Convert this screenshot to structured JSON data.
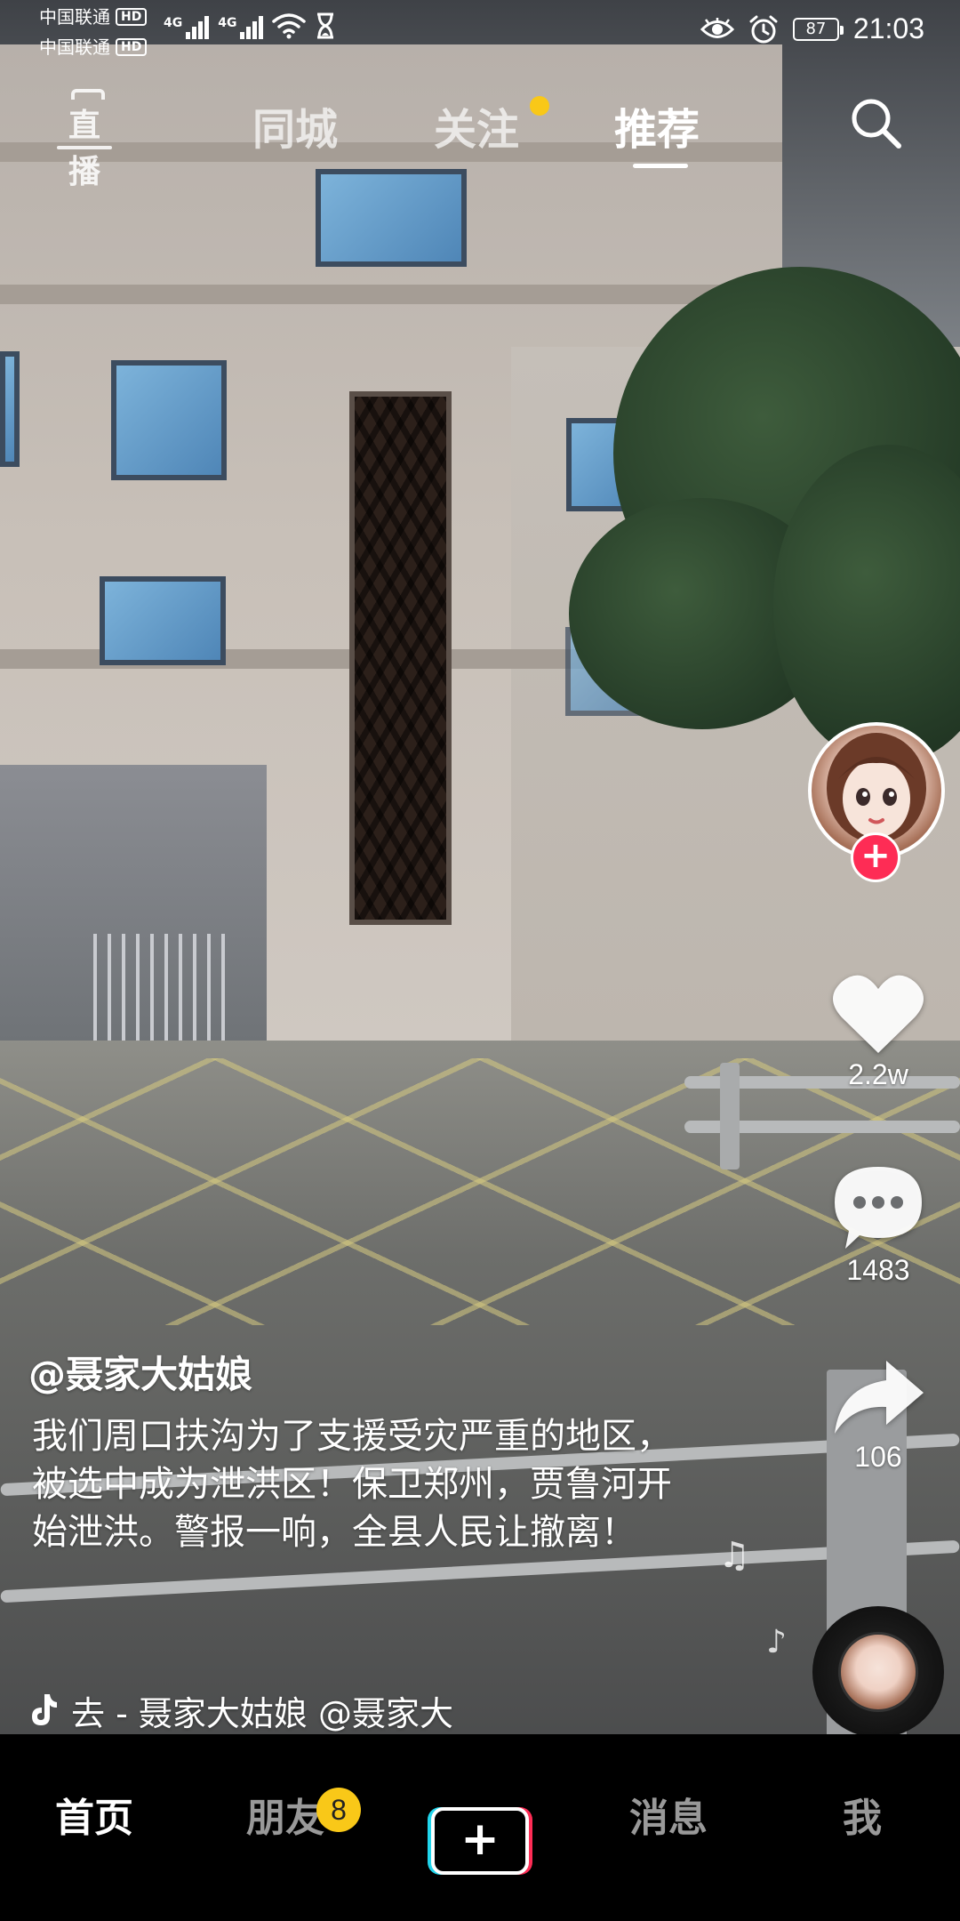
{
  "status_bar": {
    "carrier1": "中国联通",
    "carrier2": "中国联通",
    "hd": "HD",
    "net1": "4G",
    "net2": "4G",
    "battery": "87",
    "time": "21:03"
  },
  "top_nav": {
    "live": "直播",
    "tabs": [
      {
        "label": "同城"
      },
      {
        "label": "关注"
      },
      {
        "label": "推荐"
      }
    ],
    "active_tab": "推荐"
  },
  "actions": {
    "likes": "2.2w",
    "comments": "1483",
    "shares": "106"
  },
  "caption": {
    "author": "@聂家大姑娘",
    "description": "我们周口扶沟为了支援受灾严重的地区，被选中成为泄洪区！保卫郑州，贾鲁河开始泄洪。警报一响，全县人民让撤离！",
    "music": "去 - 聂家大姑娘    @聂家大"
  },
  "bottom_nav": {
    "items": [
      {
        "label": "首页"
      },
      {
        "label": "朋友"
      },
      {
        "label": "消息"
      },
      {
        "label": "我"
      }
    ],
    "friends_badge": "8",
    "create": "+"
  },
  "colors": {
    "accent_red": "#fe2c55",
    "accent_cyan": "#20d5ec",
    "badge_yellow": "#f9c818"
  }
}
